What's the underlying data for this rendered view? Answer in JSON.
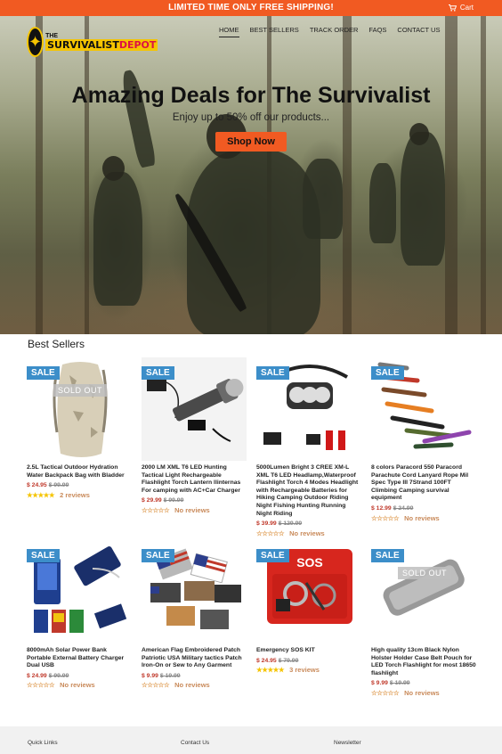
{
  "announcement": {
    "text": "LIMITED TIME ONLY FREE SHIPPING!",
    "cart_label": "Cart"
  },
  "logo": {
    "the": "THE",
    "name_part1": "SURVIVALIST",
    "name_part2": "DEPOT"
  },
  "nav": {
    "items": [
      "HOME",
      "BEST SELLERS",
      "TRACK ORDER",
      "FAQS",
      "CONTACT US"
    ],
    "active": "HOME"
  },
  "hero": {
    "title": "Amazing Deals for The Survivalist",
    "subtitle": "Enjoy up to 50% off our products...",
    "button_label": "Shop Now"
  },
  "best_sellers": {
    "title": "Best Sellers",
    "products": [
      {
        "title": "2.5L Tactical Outdoor Hydration Water Backpack Bag with Bladder",
        "price": "$ 24.95",
        "compare": "$ 99.99",
        "rating": 5,
        "reviews": "2 reviews",
        "badge": "SALE",
        "sold_out": "SOLD OUT"
      },
      {
        "title": "2000 LM XML T6 LED Hunting Tactical Light Rechargeable Flashlight Torch Lantern llinternas For camping with AC+Car Charger",
        "price": "$ 29.99",
        "compare": "$ 99.99",
        "rating": 0,
        "reviews": "No reviews",
        "badge": "SALE",
        "sold_out": ""
      },
      {
        "title": "5000Lumen Bright 3 CREE XM-L XML T6 LED Headlamp,Waterproof Flashlight Torch 4 Modes Headlight with Rechargeable Batteries for Hiking Camping Outdoor Riding Night Fishing Hunting Running Night Riding",
        "price": "$ 39.99",
        "compare": "$ 129.99",
        "rating": 0,
        "reviews": "No reviews",
        "badge": "SALE",
        "sold_out": ""
      },
      {
        "title": "8 colors Paracord 550 Paracord Parachute Cord Lanyard Rope Mil Spec Type III 7Strand 100FT Climbing Camping survival equipment",
        "price": "$ 12.99",
        "compare": "$ 24.99",
        "rating": 0,
        "reviews": "No reviews",
        "badge": "SALE",
        "sold_out": ""
      },
      {
        "title": "8000mAh Solar Power Bank Portable External Battery Charger Dual USB",
        "price": "$ 24.99",
        "compare": "$ 99.99",
        "rating": 0,
        "reviews": "No reviews",
        "badge": "SALE",
        "sold_out": ""
      },
      {
        "title": "American Flag Embroidered Patch Patriotic USA Military tactics Patch Iron-On or Sew to Any Garment",
        "price": "$ 9.99",
        "compare": "$ 19.99",
        "rating": 0,
        "reviews": "No reviews",
        "badge": "SALE",
        "sold_out": ""
      },
      {
        "title": "Emergency SOS KIT",
        "price": "$ 24.95",
        "compare": "$ 79.99",
        "rating": 5,
        "reviews": "3 reviews",
        "badge": "SALE",
        "sold_out": ""
      },
      {
        "title": "High quality 13cm Black Nylon Holster Holder Case Belt Pouch for LED Torch Flashlight for most 18650 flashlight",
        "price": "$ 9.99",
        "compare": "$ 19.99",
        "rating": 0,
        "reviews": "No reviews",
        "badge": "SALE",
        "sold_out": "SOLD OUT"
      }
    ]
  },
  "footer": {
    "quick_links": "Quick Links",
    "contact": "Contact Us",
    "newsletter": "Newsletter"
  },
  "colors": {
    "accent": "#f15a22",
    "sale_badge": "#3c8ec9",
    "price": "#c0392b",
    "star": "#f5c400"
  }
}
